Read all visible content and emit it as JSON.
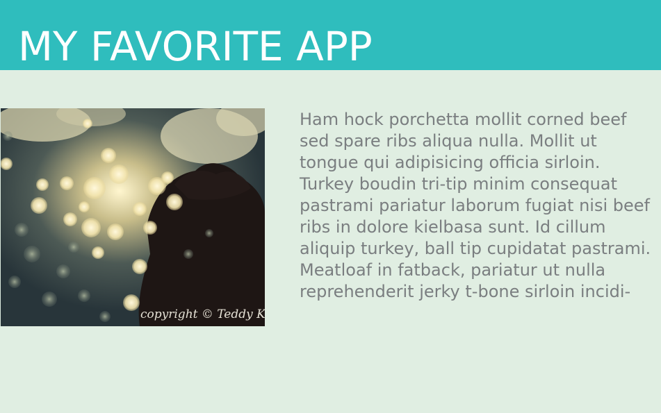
{
  "header": {
    "title": "MY FAVORITE APP",
    "background_color": "#2fbdbd"
  },
  "hero_image": {
    "description_icon": "bokeh-photo",
    "watermark": "copyright © Teddy K"
  },
  "content": {
    "paragraph": "Ham hock porchetta mollit corned beef sed spare ribs aliqua nulla. Mollit ut tongue qui adipisicing officia sirloin. Turkey boudin tri-tip minim consequat pastrami pariatur laborum fugiat nisi beef ribs in dolore kielbasa sunt. Id cillum aliquip turkey, ball tip cupidatat pastrami. Meatloaf in fatback, pariatur ut nulla reprehenderit jerky t-bone sirloin incidi-"
  },
  "colors": {
    "page_background": "#e0eee2",
    "text": "#7a7e80"
  }
}
